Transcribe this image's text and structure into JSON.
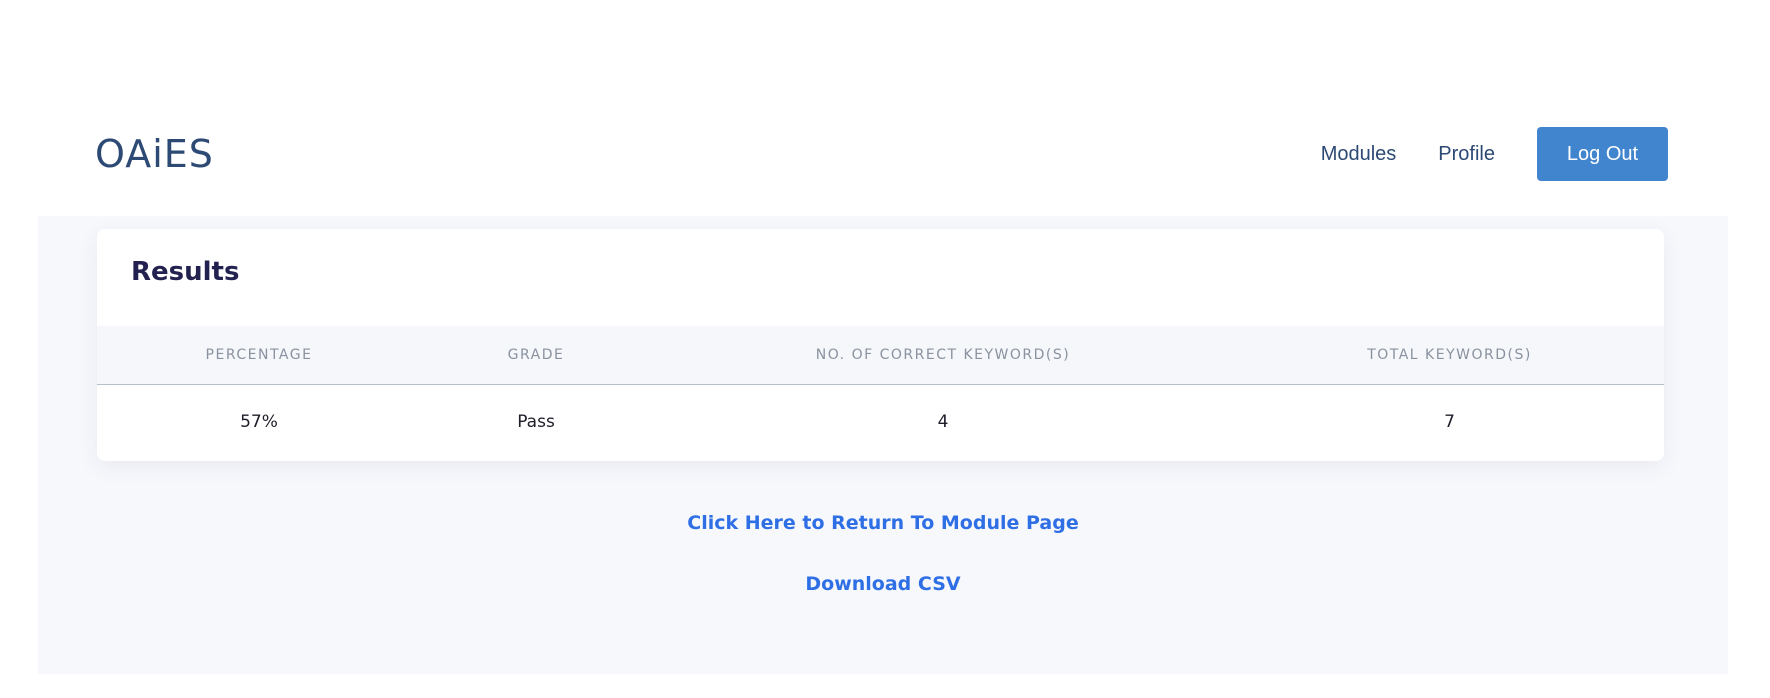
{
  "nav": {
    "brand": "OAiES",
    "links": [
      "Modules",
      "Profile"
    ],
    "logout_label": "Log Out"
  },
  "results": {
    "title": "Results",
    "columns": [
      "PERCENTAGE",
      "GRADE",
      "NO. OF CORRECT KEYWORD(S)",
      "TOTAL KEYWORD(S)"
    ],
    "rows": [
      [
        "57%",
        "Pass",
        "4",
        "7"
      ]
    ]
  },
  "links": {
    "return_label": "Click Here to Return To Module Page",
    "download_label": "Download CSV"
  },
  "colors": {
    "brand_text": "#2d4a74",
    "logout_button": "#4285cf",
    "link": "#2f6fe5",
    "main_background": "#f7f8fc",
    "title_text": "#22214f"
  }
}
